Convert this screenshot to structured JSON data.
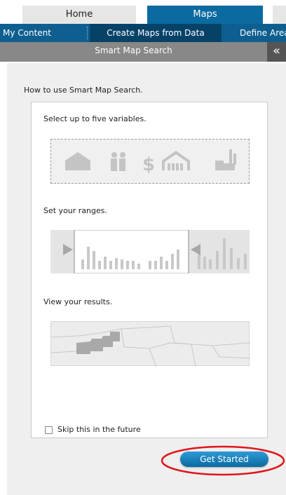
{
  "tabs": [
    {
      "label": "Home"
    },
    {
      "label": "Maps"
    }
  ],
  "subnav": {
    "items": [
      "My Content",
      "Create Maps from Data",
      "Define Area"
    ]
  },
  "panel": {
    "title": "Smart Map Search",
    "collapse_icon": "«",
    "howto": "How to use Smart Map Search.",
    "steps": [
      {
        "label": "Select up to five variables."
      },
      {
        "label": "Set your ranges."
      },
      {
        "label": "View your results."
      }
    ],
    "skip_label": "Skip this in the future",
    "skip_checked": false,
    "button_label": "Get Started"
  },
  "colors": {
    "tab_active": "#0b6aa0",
    "subnav": "#0e5f8f",
    "header_bar": "#888888",
    "highlight_ring": "#e0161b"
  },
  "icons": [
    "house-icon",
    "people-icon",
    "dollar-icon",
    "family-house-icon",
    "factory-icon"
  ]
}
